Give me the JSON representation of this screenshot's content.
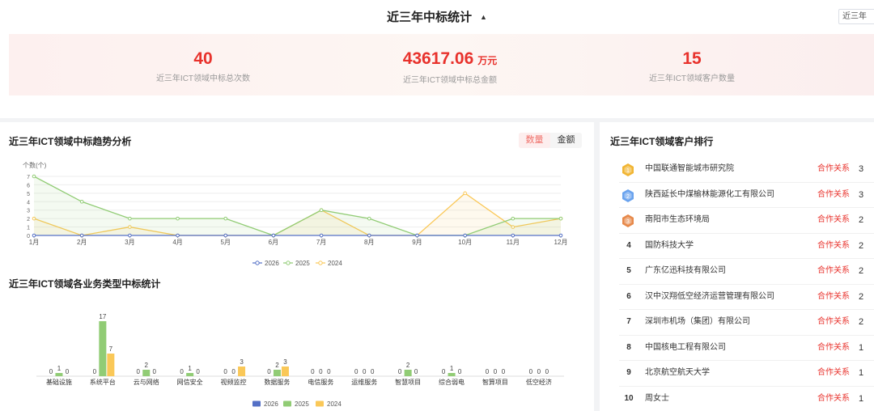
{
  "header": {
    "title": "近三年中标统计",
    "year_select": "近三年"
  },
  "stats": [
    {
      "value": "40",
      "unit": "",
      "label": "近三年ICT领域中标总次数"
    },
    {
      "value": "43617.06",
      "unit": "万元",
      "label": "近三年ICT领域中标总金额"
    },
    {
      "value": "15",
      "unit": "",
      "label": "近三年ICT领域客户数量"
    }
  ],
  "trend": {
    "title": "近三年ICT领域中标趋势分析",
    "toggle": [
      "数量",
      "金额"
    ]
  },
  "business": {
    "title": "近三年ICT领域各业务类型中标统计"
  },
  "ranking": {
    "title": "近三年ICT领域客户排行",
    "relation_label": "合作关系",
    "items": [
      {
        "rank": "1",
        "name": "中国联通智能城市研究院",
        "count": "3"
      },
      {
        "rank": "2",
        "name": "陕西延长中煤榆林能源化工有限公司",
        "count": "3"
      },
      {
        "rank": "3",
        "name": "南阳市生态环境局",
        "count": "2"
      },
      {
        "rank": "4",
        "name": "国防科技大学",
        "count": "2"
      },
      {
        "rank": "5",
        "name": "广东亿迅科技有限公司",
        "count": "2"
      },
      {
        "rank": "6",
        "name": "汉中汉翔低空经济运营管理有限公司",
        "count": "2"
      },
      {
        "rank": "7",
        "name": "深圳市机场（集团）有限公司",
        "count": "2"
      },
      {
        "rank": "8",
        "name": "中国核电工程有限公司",
        "count": "1"
      },
      {
        "rank": "9",
        "name": "北京航空航天大学",
        "count": "1"
      },
      {
        "rank": "10",
        "name": "周女士",
        "count": "1"
      }
    ],
    "badge_colors": [
      "#f1b533",
      "#6aa3ee",
      "#e7894a"
    ]
  },
  "chart_data": [
    {
      "type": "line",
      "ylabel": "个数(个)",
      "ylim": [
        0,
        7
      ],
      "y_ticks": [
        0,
        1,
        2,
        3,
        4,
        5,
        6,
        7
      ],
      "categories": [
        "1月",
        "2月",
        "3月",
        "4月",
        "5月",
        "6月",
        "7月",
        "8月",
        "9月",
        "10月",
        "11月",
        "12月"
      ],
      "series": [
        {
          "name": "2026",
          "color": "#5470c6",
          "values": [
            0,
            0,
            0,
            0,
            0,
            0,
            0,
            0,
            0,
            0,
            0,
            0
          ]
        },
        {
          "name": "2025",
          "color": "#91cc75",
          "values": [
            7,
            4,
            2,
            2,
            2,
            0,
            3,
            2,
            0,
            0,
            2,
            2
          ]
        },
        {
          "name": "2024",
          "color": "#fac858",
          "values": [
            2,
            0,
            1,
            0,
            0,
            0,
            3,
            0,
            0,
            5,
            1,
            2
          ]
        }
      ],
      "grid": true,
      "legend": "bottom"
    },
    {
      "type": "bar",
      "categories": [
        "基础设施",
        "系统平台",
        "云与网络",
        "网信安全",
        "视频监控",
        "数据服务",
        "电信服务",
        "运维服务",
        "智慧项目",
        "综合弱电",
        "智算项目",
        "低空经济"
      ],
      "series": [
        {
          "name": "2026",
          "color": "#5470c6",
          "values": [
            0,
            0,
            0,
            0,
            0,
            0,
            0,
            0,
            0,
            0,
            0,
            0
          ]
        },
        {
          "name": "2025",
          "color": "#91cc75",
          "values": [
            1,
            17,
            2,
            1,
            0,
            2,
            0,
            0,
            2,
            1,
            0,
            0
          ]
        },
        {
          "name": "2024",
          "color": "#fac858",
          "values": [
            0,
            7,
            0,
            0,
            3,
            3,
            0,
            0,
            0,
            0,
            0,
            0
          ]
        }
      ],
      "legend": "bottom"
    }
  ]
}
